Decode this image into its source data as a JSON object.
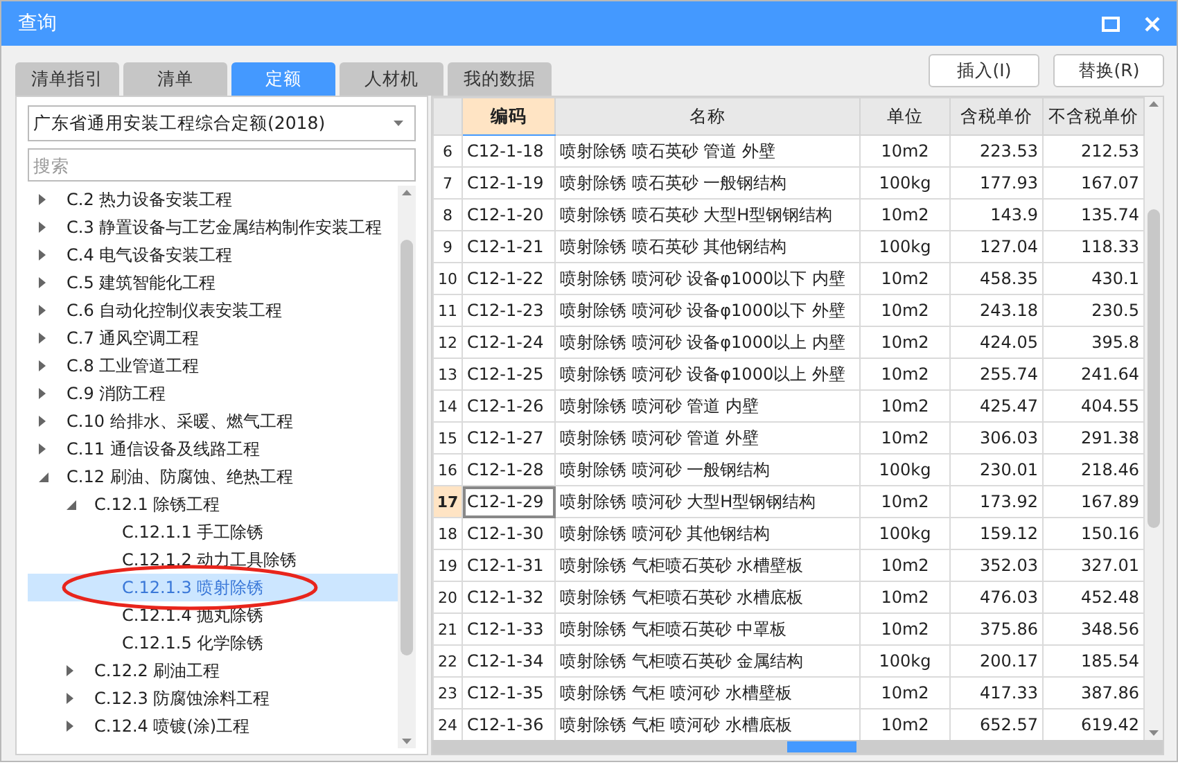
{
  "window": {
    "title": "查询"
  },
  "tabs": [
    {
      "label": "清单指引",
      "selected": false
    },
    {
      "label": "清单",
      "selected": false
    },
    {
      "label": "定额",
      "selected": true
    },
    {
      "label": "人材机",
      "selected": false
    },
    {
      "label": "我的数据",
      "selected": false
    }
  ],
  "buttons": [
    "插入(I)",
    "替换(R)"
  ],
  "library_select": {
    "value": "广东省通用安装工程综合定额(2018)"
  },
  "search": {
    "placeholder": "搜索"
  },
  "tree": {
    "items": [
      {
        "label": "C.2 热力设备安装工程",
        "expanded": false,
        "selected": false
      },
      {
        "label": "C.3 静置设备与工艺金属结构制作安装工程",
        "expanded": false,
        "selected": false
      },
      {
        "label": "C.4 电气设备安装工程",
        "expanded": false,
        "selected": false
      },
      {
        "label": "C.5 建筑智能化工程",
        "expanded": false,
        "selected": false
      },
      {
        "label": "C.6 自动化控制仪表安装工程",
        "expanded": false,
        "selected": false
      },
      {
        "label": "C.7 通风空调工程",
        "expanded": false,
        "selected": false
      },
      {
        "label": "C.8 工业管道工程",
        "expanded": false,
        "selected": false
      },
      {
        "label": "C.9 消防工程",
        "expanded": false,
        "selected": false
      },
      {
        "label": "C.10 给排水、采暖、燃气工程",
        "expanded": false,
        "selected": false
      },
      {
        "label": "C.11 通信设备及线路工程",
        "expanded": false,
        "selected": false
      },
      {
        "label": "C.12 刷油、防腐蚀、绝热工程",
        "expanded": true,
        "selected": false,
        "children": [
          {
            "label": "C.12.1 除锈工程",
            "expanded": true,
            "selected": false,
            "children": [
              {
                "label": "C.12.1.1 手工除锈",
                "selected": false
              },
              {
                "label": "C.12.1.2 动力工具除锈",
                "selected": false
              },
              {
                "label": "C.12.1.3 喷射除锈",
                "selected": true
              },
              {
                "label": "C.12.1.4 抛丸除锈",
                "selected": false
              },
              {
                "label": "C.12.1.5 化学除锈",
                "selected": false
              }
            ]
          },
          {
            "label": "C.12.2 刷油工程",
            "expanded": false,
            "selected": false
          },
          {
            "label": "C.12.3 防腐蚀涂料工程",
            "expanded": false,
            "selected": false
          },
          {
            "label": "C.12.4 喷镀(涂)工程",
            "expanded": false,
            "selected": false
          }
        ]
      }
    ]
  },
  "table": {
    "columns": [
      {
        "label": "编码",
        "selected": true
      },
      {
        "label": "名称",
        "selected": false
      },
      {
        "label": "单位",
        "selected": false
      },
      {
        "label": "含税单价",
        "selected": false
      },
      {
        "label": "不含税单价",
        "selected": false
      }
    ],
    "rows": [
      {
        "num": "6",
        "code": "C12-1-18",
        "name": "喷射除锈 喷石英砂 管道 外壁",
        "unit": "10m2",
        "price_tax": "223.53",
        "price_notax": "212.53",
        "selected": false
      },
      {
        "num": "7",
        "code": "C12-1-19",
        "name": "喷射除锈 喷石英砂 一般钢结构",
        "unit": "100kg",
        "price_tax": "177.93",
        "price_notax": "167.07",
        "selected": false
      },
      {
        "num": "8",
        "code": "C12-1-20",
        "name": "喷射除锈 喷石英砂 大型H型钢钢结构",
        "unit": "10m2",
        "price_tax": "143.9",
        "price_notax": "135.74",
        "selected": false
      },
      {
        "num": "9",
        "code": "C12-1-21",
        "name": "喷射除锈 喷石英砂 其他钢结构",
        "unit": "100kg",
        "price_tax": "127.04",
        "price_notax": "118.33",
        "selected": false
      },
      {
        "num": "10",
        "code": "C12-1-22",
        "name": "喷射除锈 喷河砂 设备φ1000以下 内壁",
        "unit": "10m2",
        "price_tax": "458.35",
        "price_notax": "430.1",
        "selected": false
      },
      {
        "num": "11",
        "code": "C12-1-23",
        "name": "喷射除锈 喷河砂 设备φ1000以下 外壁",
        "unit": "10m2",
        "price_tax": "243.18",
        "price_notax": "230.5",
        "selected": false
      },
      {
        "num": "12",
        "code": "C12-1-24",
        "name": "喷射除锈 喷河砂 设备φ1000以上 内壁",
        "unit": "10m2",
        "price_tax": "424.05",
        "price_notax": "395.8",
        "selected": false
      },
      {
        "num": "13",
        "code": "C12-1-25",
        "name": "喷射除锈 喷河砂 设备φ1000以上 外壁",
        "unit": "10m2",
        "price_tax": "255.74",
        "price_notax": "241.64",
        "selected": false
      },
      {
        "num": "14",
        "code": "C12-1-26",
        "name": "喷射除锈 喷河砂 管道 内壁",
        "unit": "10m2",
        "price_tax": "425.47",
        "price_notax": "404.55",
        "selected": false
      },
      {
        "num": "15",
        "code": "C12-1-27",
        "name": "喷射除锈 喷河砂 管道 外壁",
        "unit": "10m2",
        "price_tax": "306.03",
        "price_notax": "291.38",
        "selected": false
      },
      {
        "num": "16",
        "code": "C12-1-28",
        "name": "喷射除锈 喷河砂 一般钢结构",
        "unit": "100kg",
        "price_tax": "230.01",
        "price_notax": "218.46",
        "selected": false
      },
      {
        "num": "17",
        "code": "C12-1-29",
        "name": "喷射除锈 喷河砂 大型H型钢钢结构",
        "unit": "10m2",
        "price_tax": "173.92",
        "price_notax": "167.89",
        "selected": true
      },
      {
        "num": "18",
        "code": "C12-1-30",
        "name": "喷射除锈 喷河砂 其他钢结构",
        "unit": "100kg",
        "price_tax": "159.12",
        "price_notax": "150.16",
        "selected": false
      },
      {
        "num": "19",
        "code": "C12-1-31",
        "name": "喷射除锈 气柜喷石英砂 水槽壁板",
        "unit": "10m2",
        "price_tax": "352.03",
        "price_notax": "327.01",
        "selected": false
      },
      {
        "num": "20",
        "code": "C12-1-32",
        "name": "喷射除锈 气柜喷石英砂 水槽底板",
        "unit": "10m2",
        "price_tax": "476.03",
        "price_notax": "452.48",
        "selected": false
      },
      {
        "num": "21",
        "code": "C12-1-33",
        "name": "喷射除锈 气柜喷石英砂 中罩板",
        "unit": "10m2",
        "price_tax": "375.86",
        "price_notax": "348.56",
        "selected": false
      },
      {
        "num": "22",
        "code": "C12-1-34",
        "name": "喷射除锈 气柜喷石英砂 金属结构",
        "unit": "100kg",
        "price_tax": "200.17",
        "price_notax": "185.54",
        "selected": false
      },
      {
        "num": "23",
        "code": "C12-1-35",
        "name": "喷射除锈 气柜 喷河砂 水槽壁板",
        "unit": "10m2",
        "price_tax": "417.33",
        "price_notax": "387.86",
        "selected": false
      },
      {
        "num": "24",
        "code": "C12-1-36",
        "name": "喷射除锈 气柜 喷河砂 水槽底板",
        "unit": "10m2",
        "price_tax": "652.57",
        "price_notax": "619.42",
        "selected": false
      }
    ]
  }
}
